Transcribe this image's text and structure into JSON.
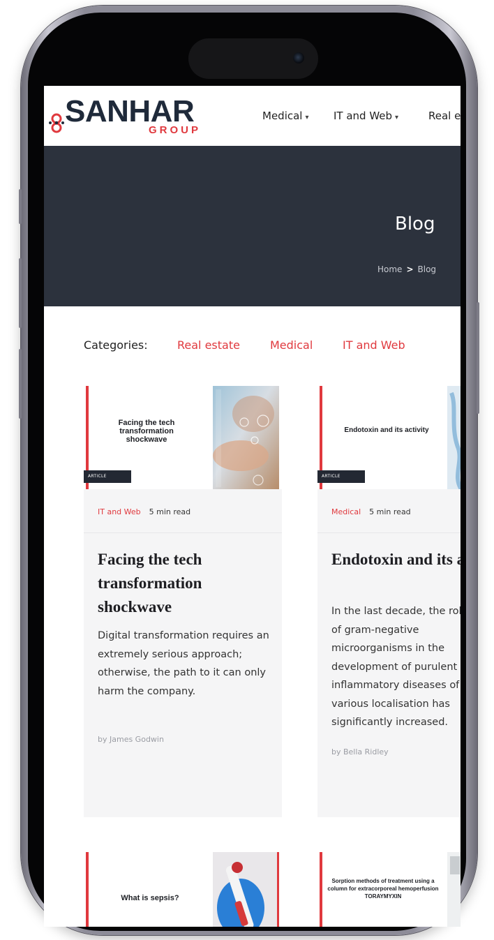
{
  "brand": {
    "name": "SANHAR",
    "sub": "GROUP",
    "accent": "#e0393e",
    "dark": "#2c323d"
  },
  "nav": {
    "items": [
      {
        "label": "Medical"
      },
      {
        "label": "IT and Web"
      },
      {
        "label": "Real e"
      }
    ]
  },
  "hero": {
    "title": "Blog",
    "breadcrumb": {
      "home": "Home",
      "separator": ">",
      "current": "Blog"
    }
  },
  "categories": {
    "label": "Categories:",
    "items": [
      "Real estate",
      "Medical",
      "IT and Web"
    ]
  },
  "posts": [
    {
      "thumb_title": "Facing the tech transformation shockwave",
      "tag": "ARTICLE",
      "category": "IT and Web",
      "read_time": "5 min read",
      "title": "Facing the tech transformation shockwave",
      "excerpt": "Digital transformation requires an extremely serious approach; otherwise, the path to it can only harm the company.",
      "author": "by James Godwin"
    },
    {
      "thumb_title": "Endotoxin and its activity",
      "tag": "ARTICLE",
      "category": "Medical",
      "read_time": "5 min read",
      "title": "Endotoxin and its activity",
      "excerpt": "In the last decade, the role of gram-negative microorganisms in the development of purulent inflammatory diseases of various localisation has significantly increased.",
      "author": "by Bella Ridley"
    },
    {
      "thumb_title": "What is sepsis?"
    },
    {
      "thumb_title": "Sorption methods of treatment using a column for extracorporeal hemoperfusion TORAYMYXIN"
    }
  ]
}
